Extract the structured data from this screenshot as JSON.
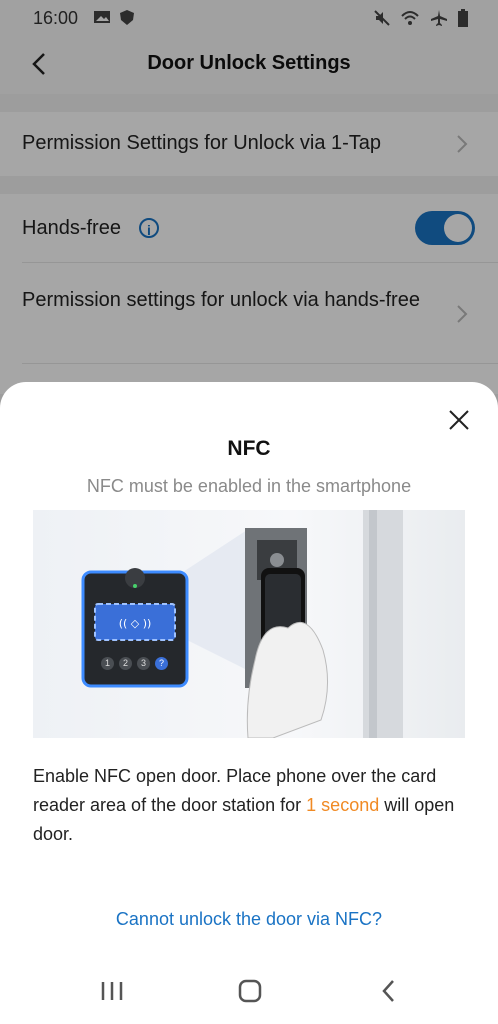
{
  "status_bar": {
    "time": "16:00"
  },
  "app_bar": {
    "title": "Door Unlock Settings"
  },
  "settings": {
    "one_tap": "Permission Settings for Unlock via 1-Tap",
    "hands_free": {
      "label": "Hands-free",
      "toggle_on": true
    },
    "hands_free_permission": "Permission settings for unlock via hands-free"
  },
  "sheet": {
    "title": "NFC",
    "subtitle": "NFC must be enabled in the smartphone",
    "description_before": "Enable NFC open door. Place phone over the card reader area of the door station for ",
    "description_highlight": "1 second",
    "description_after": " will open door.",
    "link": "Cannot unlock the door via NFC?",
    "keypad_keys": [
      "1",
      "2",
      "3",
      "?"
    ]
  },
  "colors": {
    "accent": "#1a73c4",
    "highlight": "#f08a24"
  }
}
